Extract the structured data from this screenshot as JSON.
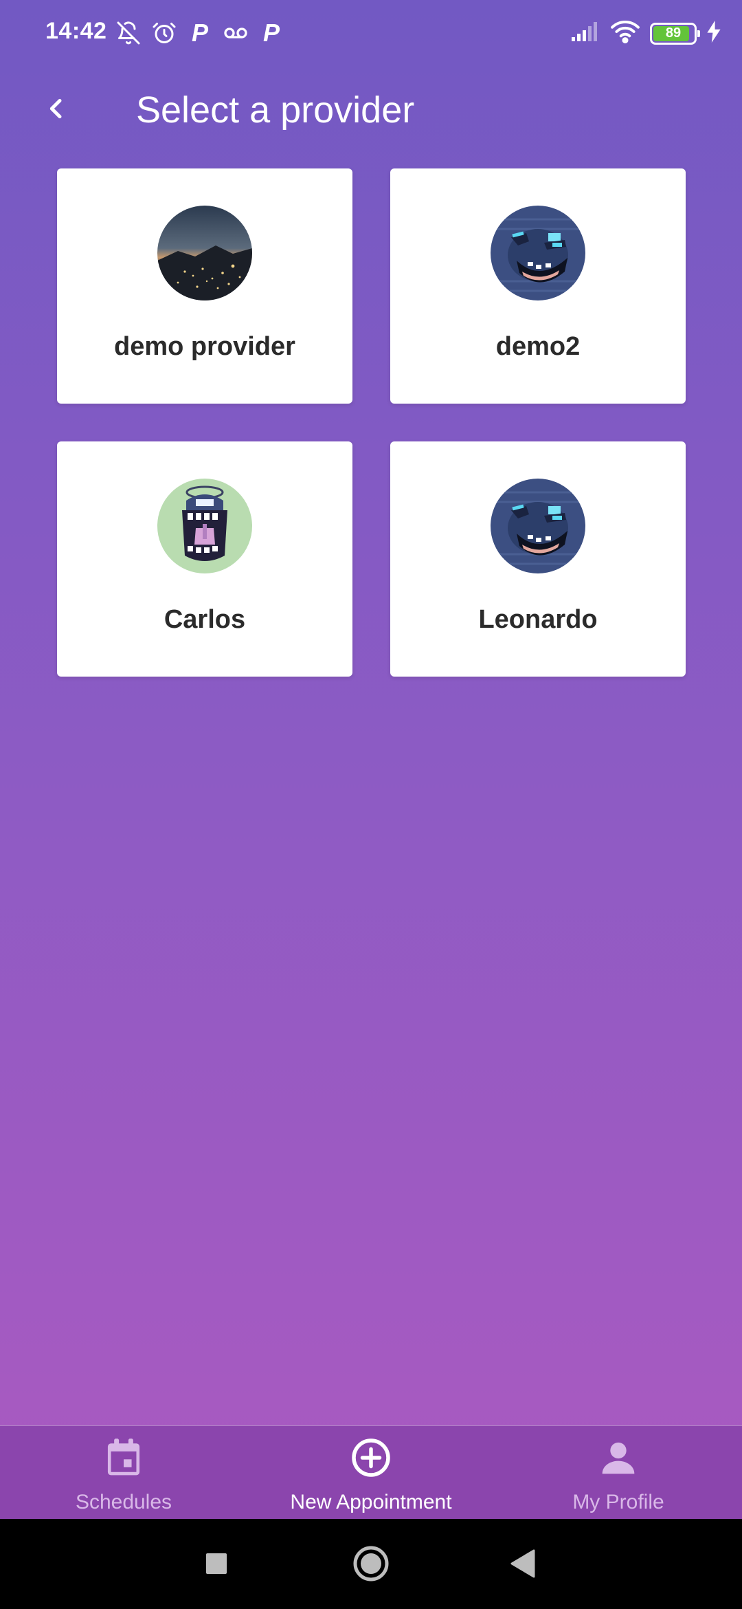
{
  "status_bar": {
    "time": "14:42",
    "battery_level": "89",
    "battery_fraction": 0.89,
    "left_icons": [
      "mute-bell-icon",
      "alarm-icon",
      "parking-p-icon",
      "voicemail-icon",
      "parking-p-icon"
    ],
    "right_icons": [
      "cellular-signal-icon",
      "wifi-icon",
      "battery-icon",
      "charging-bolt-icon"
    ],
    "p_glyph": "P"
  },
  "header": {
    "title": "Select a provider",
    "back_icon": "chevron-left-icon"
  },
  "providers": [
    {
      "name": "demo provider",
      "avatar": "city-night-photo"
    },
    {
      "name": "demo2",
      "avatar": "blue-creature-face"
    },
    {
      "name": "Carlos",
      "avatar": "screaming-creature-face"
    },
    {
      "name": "Leonardo",
      "avatar": "blue-creature-face"
    }
  ],
  "bottom_nav": {
    "items": [
      {
        "label": "Schedules",
        "icon": "calendar-icon",
        "active": false
      },
      {
        "label": "New Appointment",
        "icon": "plus-circle-icon",
        "active": true
      },
      {
        "label": "My Profile",
        "icon": "person-icon",
        "active": false
      }
    ]
  },
  "system_nav": {
    "buttons": [
      "recents-square-icon",
      "home-circle-icon",
      "back-triangle-icon"
    ]
  },
  "colors": {
    "gradient_top": "#7259c3",
    "gradient_bottom": "#ae59c0",
    "nav_background": "#8b45ad",
    "nav_inactive": "#d9b8e8",
    "battery_green": "#63c43a"
  }
}
